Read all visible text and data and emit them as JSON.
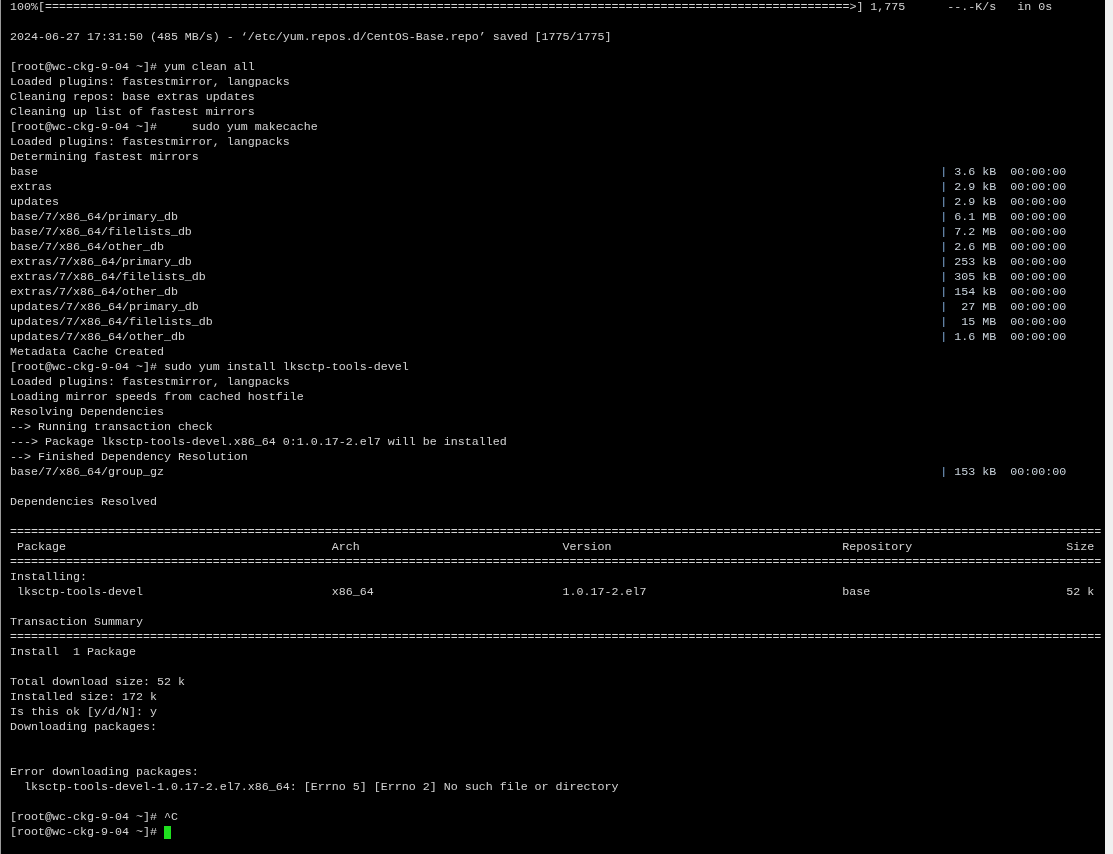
{
  "lines": [
    {
      "kind": "text",
      "text": "100%[===================================================================================================================>] 1,775      --.-K/s   in 0s"
    },
    {
      "kind": "blank"
    },
    {
      "kind": "text",
      "text": "2024-06-27 17:31:50 (485 MB/s) - ‘/etc/yum.repos.d/CentOS-Base.repo’ saved [1775/1775]"
    },
    {
      "kind": "blank"
    },
    {
      "kind": "text",
      "text": "[root@wc-ckg-9-04 ~]# yum clean all"
    },
    {
      "kind": "text",
      "text": "Loaded plugins: fastestmirror, langpacks"
    },
    {
      "kind": "text",
      "text": "Cleaning repos: base extras updates"
    },
    {
      "kind": "text",
      "text": "Cleaning up list of fastest mirrors"
    },
    {
      "kind": "text",
      "text": "[root@wc-ckg-9-04 ~]#     sudo yum makecache"
    },
    {
      "kind": "text",
      "text": "Loaded plugins: fastestmirror, langpacks"
    },
    {
      "kind": "text",
      "text": "Determining fastest mirrors"
    },
    {
      "kind": "stat",
      "name": "base",
      "bar": "|",
      "size": "3.6 kB",
      "time": "00:00:00"
    },
    {
      "kind": "stat",
      "name": "extras",
      "bar": "|",
      "size": "2.9 kB",
      "time": "00:00:00"
    },
    {
      "kind": "stat",
      "name": "updates",
      "bar": "|",
      "size": "2.9 kB",
      "time": "00:00:00"
    },
    {
      "kind": "stat",
      "name": "base/7/x86_64/primary_db",
      "bar": "|",
      "size": "6.1 MB",
      "time": "00:00:00"
    },
    {
      "kind": "stat",
      "name": "base/7/x86_64/filelists_db",
      "bar": "|",
      "size": "7.2 MB",
      "time": "00:00:00"
    },
    {
      "kind": "stat",
      "name": "base/7/x86_64/other_db",
      "bar": "|",
      "size": "2.6 MB",
      "time": "00:00:00"
    },
    {
      "kind": "stat",
      "name": "extras/7/x86_64/primary_db",
      "bar": "|",
      "size": "253 kB",
      "time": "00:00:00"
    },
    {
      "kind": "stat",
      "name": "extras/7/x86_64/filelists_db",
      "bar": "|",
      "size": "305 kB",
      "time": "00:00:00"
    },
    {
      "kind": "stat",
      "name": "extras/7/x86_64/other_db",
      "bar": "|",
      "size": "154 kB",
      "time": "00:00:00"
    },
    {
      "kind": "stat",
      "name": "updates/7/x86_64/primary_db",
      "bar": "|",
      "size": "27 MB",
      "time": "00:00:00"
    },
    {
      "kind": "stat",
      "name": "updates/7/x86_64/filelists_db",
      "bar": "|",
      "size": "15 MB",
      "time": "00:00:00"
    },
    {
      "kind": "stat",
      "name": "updates/7/x86_64/other_db",
      "bar": "|",
      "size": "1.6 MB",
      "time": "00:00:00"
    },
    {
      "kind": "text",
      "text": "Metadata Cache Created"
    },
    {
      "kind": "text",
      "text": "[root@wc-ckg-9-04 ~]# sudo yum install lksctp-tools-devel"
    },
    {
      "kind": "text",
      "text": "Loaded plugins: fastestmirror, langpacks"
    },
    {
      "kind": "text",
      "text": "Loading mirror speeds from cached hostfile"
    },
    {
      "kind": "text",
      "text": "Resolving Dependencies"
    },
    {
      "kind": "text",
      "text": "--> Running transaction check"
    },
    {
      "kind": "text",
      "text": "---> Package lksctp-tools-devel.x86_64 0:1.0.17-2.el7 will be installed"
    },
    {
      "kind": "text",
      "text": "--> Finished Dependency Resolution"
    },
    {
      "kind": "stat",
      "name": "base/7/x86_64/group_gz",
      "bar": "|",
      "size": "153 kB",
      "time": "00:00:00"
    },
    {
      "kind": "blank"
    },
    {
      "kind": "text",
      "text": "Dependencies Resolved"
    },
    {
      "kind": "blank"
    },
    {
      "kind": "text",
      "text": "============================================================================================================================================================"
    },
    {
      "kind": "table_header",
      "cells": [
        "Package",
        "Arch",
        "Version",
        "Repository",
        "Size"
      ]
    },
    {
      "kind": "text",
      "text": "============================================================================================================================================================"
    },
    {
      "kind": "text",
      "text": "Installing:"
    },
    {
      "kind": "table_row",
      "cells": [
        "lksctp-tools-devel",
        "x86_64",
        "1.0.17-2.el7",
        "base",
        "52 k"
      ]
    },
    {
      "kind": "blank"
    },
    {
      "kind": "text",
      "text": "Transaction Summary"
    },
    {
      "kind": "text",
      "text": "============================================================================================================================================================"
    },
    {
      "kind": "text",
      "text": "Install  1 Package"
    },
    {
      "kind": "blank"
    },
    {
      "kind": "text",
      "text": "Total download size: 52 k"
    },
    {
      "kind": "text",
      "text": "Installed size: 172 k"
    },
    {
      "kind": "text",
      "text": "Is this ok [y/d/N]: y"
    },
    {
      "kind": "text",
      "text": "Downloading packages:"
    },
    {
      "kind": "blank"
    },
    {
      "kind": "blank"
    },
    {
      "kind": "text",
      "text": "Error downloading packages:"
    },
    {
      "kind": "text",
      "text": "  lksctp-tools-devel-1.0.17-2.el7.x86_64: [Errno 5] [Errno 2] No such file or directory"
    },
    {
      "kind": "blank"
    },
    {
      "kind": "text",
      "text": "[root@wc-ckg-9-04 ~]# ^C"
    },
    {
      "kind": "text",
      "text": "[root@wc-ckg-9-04 ~]# ",
      "cursor": true
    }
  ]
}
